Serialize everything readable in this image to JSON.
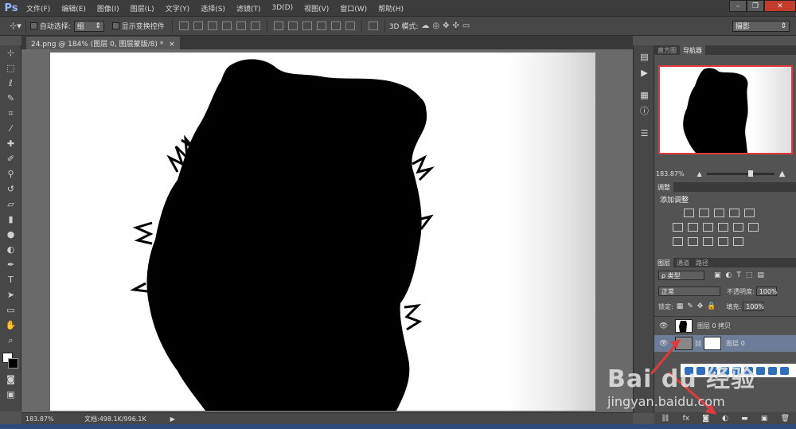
{
  "app": {
    "logo": "Ps",
    "menu": [
      "文件(F)",
      "编辑(E)",
      "图像(I)",
      "图层(L)",
      "文字(Y)",
      "选择(S)",
      "滤镜(T)",
      "3D(D)",
      "视图(V)",
      "窗口(W)",
      "帮助(H)"
    ]
  },
  "options": {
    "auto_select_label": "自动选择:",
    "auto_select_value": "组",
    "show_transform_label": "显示变换控件",
    "mode_3d_label": "3D 模式:",
    "workspace": "摄影"
  },
  "document": {
    "tab_title": "24.png @ 184% (图层 0, 图层蒙版/8) *",
    "tab_close": "×"
  },
  "status": {
    "zoom": "183.87%",
    "doc_info": "文档:498.1K/996.1K",
    "arrow": "▶"
  },
  "navigator": {
    "tabs": [
      "直方图",
      "导航器"
    ],
    "zoom": "183.87%"
  },
  "adjustments": {
    "tab": "调整",
    "title": "添加调整"
  },
  "layers": {
    "tabs": [
      "图层",
      "通道",
      "路径"
    ],
    "filter_kind": "ρ 类型",
    "blend_mode": "正常",
    "opacity_label": "不透明度:",
    "opacity_value": "100%",
    "lock_label": "锁定:",
    "fill_label": "填充:",
    "fill_value": "100%",
    "items": [
      {
        "name": "图层 0 拷贝",
        "visible": true,
        "selected": false
      },
      {
        "name": "图层 0",
        "visible": true,
        "selected": true
      }
    ]
  },
  "watermark": {
    "brand": "Bai du 经验",
    "url": "jingyan.baidu.com"
  },
  "colors": {
    "accent": "#e03a3a",
    "selected_layer": "#6b7d98"
  }
}
